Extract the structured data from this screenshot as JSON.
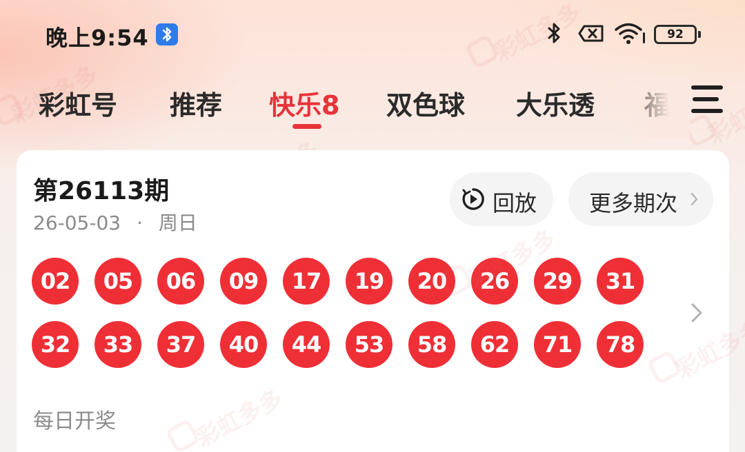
{
  "status_bar": {
    "time": "晚上9:54",
    "battery": "92",
    "icons": [
      "bluetooth-badge-icon",
      "bluetooth-icon",
      "no-sim-icon",
      "wifi-icon",
      "battery-icon"
    ]
  },
  "tabs": [
    {
      "label": "彩虹号",
      "active": false
    },
    {
      "label": "推荐",
      "active": false
    },
    {
      "label": "快乐8",
      "active": true
    },
    {
      "label": "双色球",
      "active": false
    },
    {
      "label": "大乐透",
      "active": false
    },
    {
      "label": "福",
      "active": false
    }
  ],
  "draw": {
    "issue": "第26113期",
    "date": "26-05-03",
    "separator": "·",
    "weekday": "周日",
    "replay_label": "回放",
    "more_label": "更多期次",
    "numbers_row1": [
      "02",
      "05",
      "06",
      "09",
      "17",
      "19",
      "20",
      "26",
      "29",
      "31"
    ],
    "numbers_row2": [
      "32",
      "33",
      "37",
      "40",
      "44",
      "53",
      "58",
      "62",
      "71",
      "78"
    ],
    "note": "每日开奖"
  },
  "watermark": "彩虹多多",
  "colors": {
    "accent": "#e8333a",
    "ball": "#ef2f36",
    "muted_text": "#8a8a8a",
    "pill_bg": "#f4f4f5"
  }
}
